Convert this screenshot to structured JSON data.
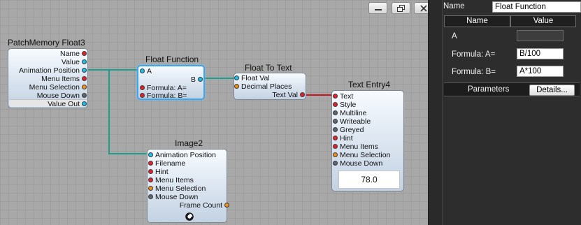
{
  "window_controls": {
    "minimize_icon": "minimize-icon",
    "restore_icon": "restore-icon",
    "close_icon": "close-icon"
  },
  "nodes": {
    "patch_memory": {
      "title": "PatchMemory Float3",
      "pins": [
        "Name",
        "Value",
        "Animation Position",
        "Menu Items",
        "Menu Selection",
        "Mouse Down",
        "Value Out"
      ]
    },
    "float_function": {
      "title": "Float Function",
      "input_a": "A",
      "output_b": "B",
      "formula_a": "Formula: A=",
      "formula_b": "Formula: B="
    },
    "float_to_text": {
      "title": "Float To Text",
      "float_val": "Float Val",
      "decimal_places": "Decimal Places",
      "text_val": "Text Val"
    },
    "text_entry": {
      "title": "Text Entry4",
      "pins": [
        "Text",
        "Style",
        "Multiline",
        "Writeable",
        "Greyed",
        "Hint",
        "Menu Items",
        "Menu Selection",
        "Mouse Down"
      ],
      "value": "78.0"
    },
    "image": {
      "title": "Image2",
      "pins": [
        "Animation Position",
        "Filename",
        "Hint",
        "Menu Items",
        "Menu Selection",
        "Mouse Down"
      ],
      "frame_count": "Frame Count"
    }
  },
  "panel": {
    "name_label": "Name",
    "name_value": "Float Function",
    "col_name": "Name",
    "col_value": "Value",
    "rows": [
      {
        "label": "A",
        "value": ""
      },
      {
        "label": "Formula: A=",
        "value": "B/100"
      },
      {
        "label": "Formula: B=",
        "value": "A*100"
      }
    ],
    "parameters_label": "Parameters",
    "details_button": "Details..."
  },
  "colors": {
    "wire_teal": "#1e9e8c",
    "wire_red": "#c8141e",
    "selection_blue": "#3aa7ee",
    "pin_red": "#e8202b",
    "pin_cyan": "#19c0ee",
    "pin_orange": "#f39014",
    "pin_grey": "#5e6670"
  }
}
